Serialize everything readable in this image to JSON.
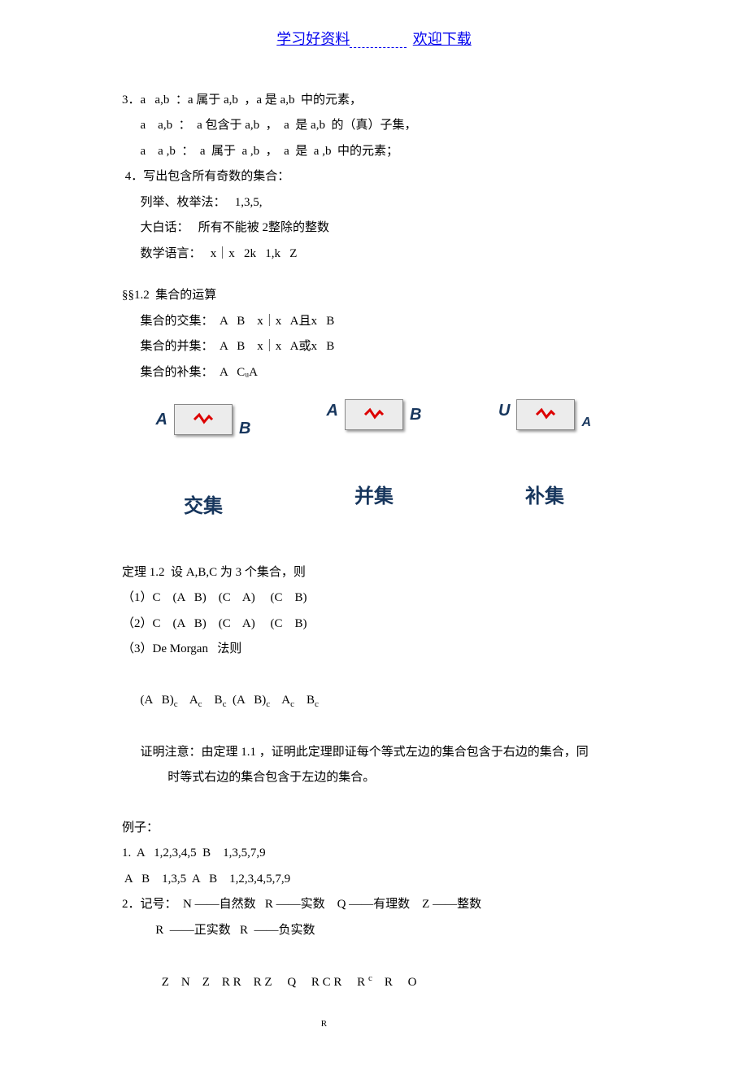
{
  "header": {
    "left": "学习好资料",
    "right": "欢迎下载"
  },
  "lines": {
    "l3a": "3．a   a,b  ：a 属于 a,b  ，a 是 a,b  中的元素，",
    "l3b": "      a    a,b  ：  a 包含于 a,b  ，  a  是 a,b  的（真）子集，",
    "l3c": "      a    a ,b  ：  a  属于  a ,b  ，  a  是  a ,b  中的元素；",
    "l4a": " 4．写出包含所有奇数的集合：",
    "l4b": "      列举、枚举法：   1,3,5,",
    "l4c": "      大白话：   所有不能被 2整除的整数",
    "l4d": "      数学语言：   x｜x   2k   1,k   Z",
    "s12": "§§1.2  集合的运算",
    "s12a": "      集合的交集：  A   B    x｜x   A且x   B",
    "s12b": "      集合的并集：  A   B    x｜x   A或x   B",
    "s12c": "      集合的补集：  A   CᵤA    ",
    "diag": {
      "l1": {
        "a": "A",
        "b": "B"
      },
      "l2": {
        "a": "A",
        "b": "B"
      },
      "l3": {
        "u": "U",
        "a": "A"
      },
      "t1": "交集",
      "t2": "并集",
      "t3": "补集"
    },
    "t12": "定理 1.2  设 A,B,C 为 3 个集合，则",
    "t12a": "（1）C    (A   B)    (C    A)     (C    B)",
    "t12b": "（2）C    (A   B)    (C    A)     (C    B)",
    "t12c": "（3）De Morgan   法则",
    "t12d": "(A   B)c    Ac    Bc  (A   B)c    Ac    Bc",
    "t12e": "      证明注意：由定理 1.1 ，证明此定理即证每个等式左边的集合包含于右边的集合，同",
    "t12f": "               时等式右边的集合包含于左边的集合。",
    "ex": "例子：",
    "ex1": "1.  A   1,2,3,4,5  B    1,3,5,7,9",
    "ex1b": " A   B    1,3,5  A   B    1,2,3,4,5,7,9",
    "ex2": "2．记号：  N ——自然数   R ——实数    Q ——有理数    Z ——整数",
    "ex2b": "           R  ——正实数   R  ——负实数",
    "ex2c_1": "       Z    N    Z    R R    R Z     Q     R C R     R ",
    "ex2c_sup": "c",
    "ex2c_2": "    R     O",
    "ex2c_sub": "R"
  }
}
